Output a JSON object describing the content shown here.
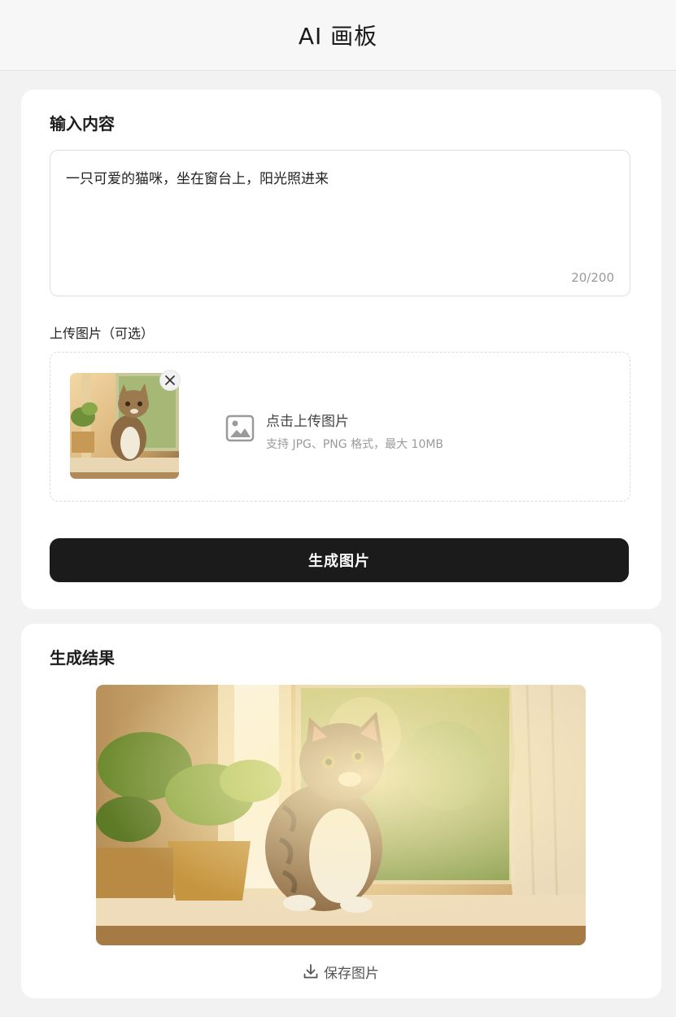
{
  "header": {
    "title": "AI 画板"
  },
  "input_card": {
    "title": "输入内容",
    "prompt": {
      "value": "一只可爱的猫咪，坐在窗台上，阳光照进来",
      "count": "20/200"
    },
    "upload": {
      "label": "上传图片（可选）",
      "trigger_title": "点击上传图片",
      "trigger_hint": "支持 JPG、PNG 格式，最大 10MB"
    },
    "generate_label": "生成图片"
  },
  "result_card": {
    "title": "生成结果",
    "save_label": "保存图片"
  },
  "icons": {
    "remove": "close-icon",
    "upload": "image-icon",
    "save": "download-icon"
  },
  "colors": {
    "primary_button": "#1b1b1b",
    "background": "#f2f2f2",
    "card": "#ffffff"
  }
}
